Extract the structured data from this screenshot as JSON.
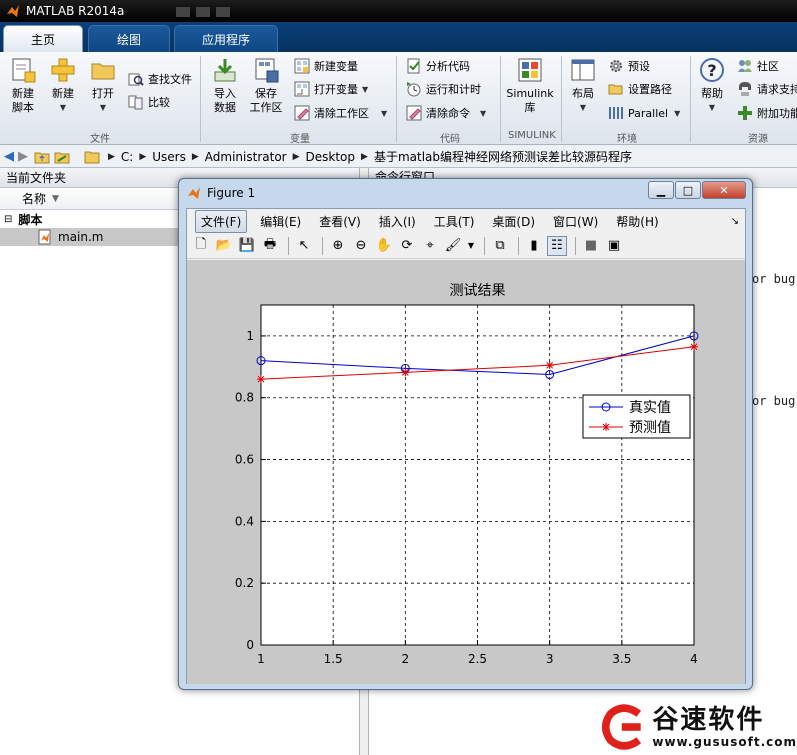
{
  "app": {
    "title": "MATLAB R2014a"
  },
  "ribbon_tabs": [
    "主页",
    "绘图",
    "应用程序"
  ],
  "ribbon": {
    "file_group": {
      "label": "文件",
      "new_script": "新建\n脚本",
      "new": "新建",
      "open": "打开",
      "find_files": "查找文件",
      "compare": "比较"
    },
    "variable_group": {
      "label": "变量",
      "import_data": "导入\n数据",
      "save_workspace": "保存\n工作区",
      "new_variable": "新建变量",
      "open_variable": "打开变量",
      "clear_workspace": "清除工作区"
    },
    "code_group": {
      "label": "代码",
      "analyze_code": "分析代码",
      "run_and_time": "运行和计时",
      "clear_commands": "清除命令"
    },
    "simulink_group": {
      "label": "SIMULINK",
      "library": "Simulink\n库"
    },
    "environment_group": {
      "label": "环境",
      "layout": "布局",
      "preferences": "预设",
      "set_path": "设置路径",
      "parallel": "Parallel"
    },
    "resources_group": {
      "label": "资源",
      "help": "帮助",
      "community": "社区",
      "request_support": "请求支持",
      "add_ons": "附加功能"
    }
  },
  "address": {
    "path": [
      "C:",
      "Users",
      "Administrator",
      "Desktop",
      "基于matlab编程神经网络预测误差比较源码程序"
    ]
  },
  "current_folder": {
    "title": "当前文件夹",
    "column_name": "名称",
    "group": "脚本",
    "files": [
      "main.m"
    ]
  },
  "command_window": {
    "title": "命令行窗口",
    "snippets": [
      "or bug",
      "or bug"
    ]
  },
  "figure": {
    "window_title": "Figure 1",
    "menus": [
      "文件(F)",
      "编辑(E)",
      "查看(V)",
      "插入(I)",
      "工具(T)",
      "桌面(D)",
      "窗口(W)",
      "帮助(H)"
    ],
    "active_menu": 0
  },
  "chart_data": {
    "type": "line",
    "title": "测试结果",
    "xlabel": "",
    "ylabel": "",
    "x": [
      1,
      2,
      3,
      4
    ],
    "xlim": [
      1,
      4
    ],
    "ylim": [
      0,
      1.1
    ],
    "xticks": [
      1,
      1.5,
      2,
      2.5,
      3,
      3.5,
      4
    ],
    "yticks": [
      0,
      0.2,
      0.4,
      0.6,
      0.8,
      1
    ],
    "grid": true,
    "legend_position": "right",
    "series": [
      {
        "name": "真实值",
        "values": [
          0.92,
          0.895,
          0.875,
          1.0
        ],
        "color": "#0000cc",
        "marker": "circle"
      },
      {
        "name": "预测值",
        "values": [
          0.86,
          0.882,
          0.905,
          0.965
        ],
        "color": "#dd0000",
        "marker": "star"
      }
    ]
  },
  "watermark": {
    "title": "谷速软件",
    "url": "www.gususoft.com"
  }
}
